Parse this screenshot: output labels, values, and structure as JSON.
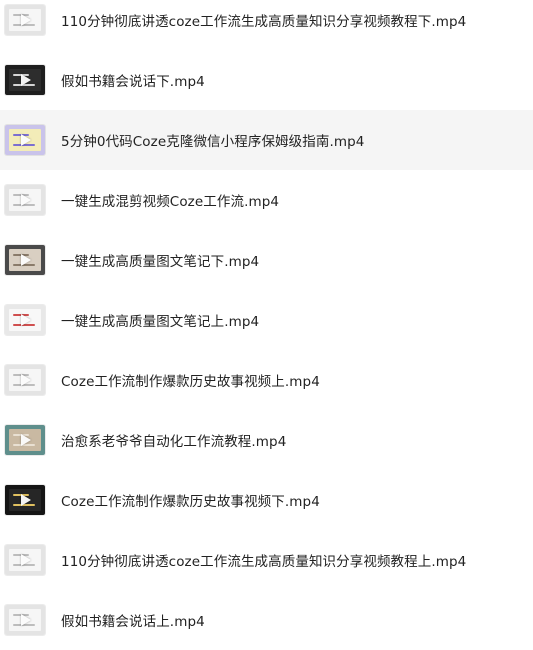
{
  "files": [
    {
      "name": "110分钟彻底讲透coze工作流生成高质量知识分享视频教程下.mp4",
      "thumb": "light-gray"
    },
    {
      "name": "假如书籍会说话下.mp4",
      "thumb": "dark"
    },
    {
      "name": "5分钟0代码Coze克隆微信小程序保姆级指南.mp4",
      "thumb": "purple-yellow",
      "hovered": true
    },
    {
      "name": "一键生成混剪视频Coze工作流.mp4",
      "thumb": "light-gray"
    },
    {
      "name": "一键生成高质量图文笔记下.mp4",
      "thumb": "dark-beige"
    },
    {
      "name": "一键生成高质量图文笔记上.mp4",
      "thumb": "light-red"
    },
    {
      "name": "Coze工作流制作爆款历史故事视频上.mp4",
      "thumb": "light-gray"
    },
    {
      "name": "治愈系老爷爷自动化工作流教程.mp4",
      "thumb": "teal-photo"
    },
    {
      "name": "Coze工作流制作爆款历史故事视频下.mp4",
      "thumb": "dark-spotted"
    },
    {
      "name": "110分钟彻底讲透coze工作流生成高质量知识分享视频教程上.mp4",
      "thumb": "light-gray"
    },
    {
      "name": "假如书籍会说话上.mp4",
      "thumb": "light-gray"
    }
  ],
  "thumb_styles": {
    "light-gray": {
      "bg": "#e4e4e4",
      "win": "#f6f6f6",
      "line": "#bdbdbd"
    },
    "dark": {
      "bg": "#1e1e1e",
      "win": "#2d2d2d",
      "line": "#d5d5d5"
    },
    "purple-yellow": {
      "bg": "#c9c3ea",
      "win": "#f3ecb8",
      "line": "#7c6fd0"
    },
    "dark-beige": {
      "bg": "#4a4a4a",
      "win": "#d9cfc2",
      "line": "#8a7b6a"
    },
    "light-red": {
      "bg": "#e8e8e8",
      "win": "#f8f8f8",
      "line": "#d05050"
    },
    "teal-photo": {
      "bg": "#5f8f8c",
      "win": "#c9b9a2",
      "line": "#e9e0d2"
    },
    "dark-spotted": {
      "bg": "#151515",
      "win": "#262626",
      "line": "#e0c060"
    }
  },
  "hover_color": "#f5f5f5"
}
